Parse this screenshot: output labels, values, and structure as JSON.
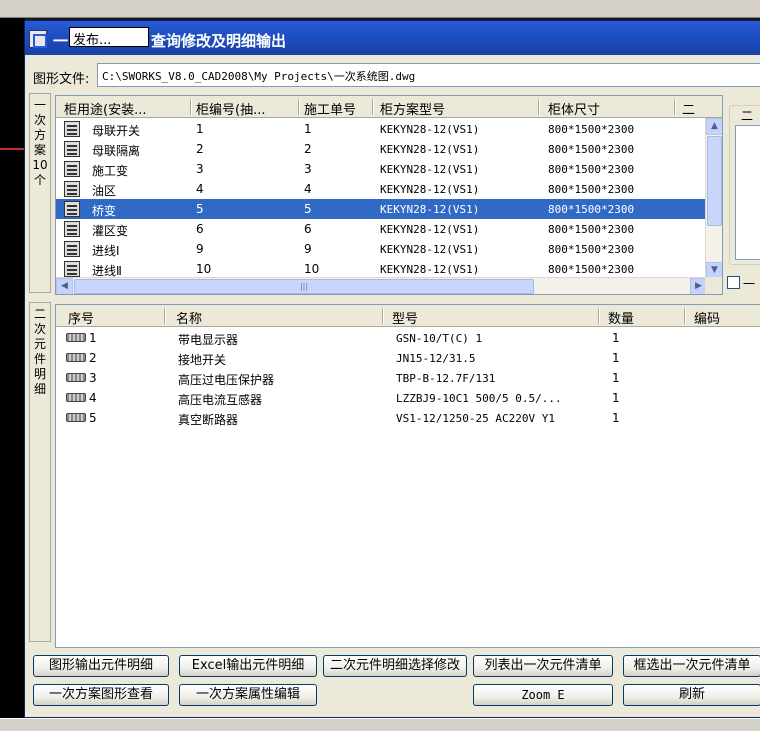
{
  "dialog": {
    "title_prefix": "一",
    "title_text": "查询修改及明细输出",
    "publish_popup": "发布..."
  },
  "file": {
    "label": "图形文件:",
    "path": "C:\\SWORKS_V8.0_CAD2008\\My Projects\\一次系统图.dwg"
  },
  "tabs": {
    "primary": [
      "一",
      "次",
      "方",
      "案",
      "10",
      "个"
    ],
    "secondary": [
      "二",
      "次",
      "元",
      "件",
      "明",
      "细"
    ]
  },
  "upper_table": {
    "columns": [
      "柜用途(安装...",
      "柜编号(抽...",
      "施工单号",
      "柜方案型号",
      "柜体尺寸",
      "二"
    ],
    "rows": [
      {
        "use": "母联开关",
        "no": "1",
        "order": "1",
        "model": "KEKYN28-12(VS1)",
        "size": "800*1500*2300"
      },
      {
        "use": "母联隔离",
        "no": "2",
        "order": "2",
        "model": "KEKYN28-12(VS1)",
        "size": "800*1500*2300"
      },
      {
        "use": "施工变",
        "no": "3",
        "order": "3",
        "model": "KEKYN28-12(VS1)",
        "size": "800*1500*2300"
      },
      {
        "use": "油区",
        "no": "4",
        "order": "4",
        "model": "KEKYN28-12(VS1)",
        "size": "800*1500*2300"
      },
      {
        "use": "桥变",
        "no": "5",
        "order": "5",
        "model": "KEKYN28-12(VS1)",
        "size": "800*1500*2300"
      },
      {
        "use": "灌区变",
        "no": "6",
        "order": "6",
        "model": "KEKYN28-12(VS1)",
        "size": "800*1500*2300"
      },
      {
        "use": "进线Ⅰ",
        "no": "9",
        "order": "9",
        "model": "KEKYN28-12(VS1)",
        "size": "800*1500*2300"
      },
      {
        "use": "进线Ⅱ",
        "no": "10",
        "order": "10",
        "model": "KEKYN28-12(VS1)",
        "size": "800*1500*2300"
      }
    ],
    "selected_index": 4
  },
  "right_panel": {
    "group_title": "二",
    "checkbox_label": "一"
  },
  "lower_table": {
    "columns": [
      "序号",
      "名称",
      "型号",
      "数量",
      "编码"
    ],
    "rows": [
      {
        "seq": "1",
        "name": "带电显示器",
        "model": "GSN-10/T(C) 1",
        "qty": "1"
      },
      {
        "seq": "2",
        "name": "接地开关",
        "model": "JN15-12/31.5",
        "qty": "1"
      },
      {
        "seq": "3",
        "name": "高压过电压保护器",
        "model": "TBP-B-12.7F/131",
        "qty": "1"
      },
      {
        "seq": "4",
        "name": "高压电流互感器",
        "model": "LZZBJ9-10C1 500/5 0.5/...",
        "qty": "1"
      },
      {
        "seq": "5",
        "name": "真空断路器",
        "model": "VS1-12/1250-25 AC220V Y1",
        "qty": "1"
      }
    ]
  },
  "buttons": {
    "graphic_output": "图形输出元件明细",
    "excel_output": "Excel输出元件明细",
    "secondary_edit": "二次元件明细选择修改",
    "list_primary": "列表出一次元件清单",
    "box_select_primary": "框选出一次元件清单",
    "view_primary_graphic": "一次方案图形查看",
    "edit_primary_props": "一次方案属性编辑",
    "zoom": "Zoom E",
    "refresh": "刷新"
  }
}
